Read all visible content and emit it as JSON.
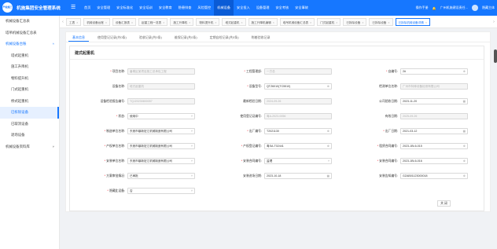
{
  "header": {
    "logo_text": "产权施工",
    "title": "机施集团安全管理系统",
    "menu_icon": "menu-icon",
    "nav": [
      "首页",
      "安全管理",
      "安全标准化",
      "安全培训",
      "安全教育",
      "隐患排查",
      "风险管控",
      "机械设备",
      "安全投入",
      "设备管理",
      "安全考核",
      "安全事故"
    ],
    "active_nav": 7,
    "manual": "操作手册",
    "user": "广州机施建设责任...",
    "account": "隐藏主体"
  },
  "sidebar": {
    "items": [
      {
        "label": "机械设备汇总表",
        "level": 0
      },
      {
        "label": "塔吊机械设备汇总表",
        "level": 0
      },
      {
        "label": "机械设备台账",
        "level": 0,
        "open": true
      },
      {
        "label": "塔式起重机",
        "level": 1
      },
      {
        "label": "施工升降机",
        "level": 1
      },
      {
        "label": "物料提升机",
        "level": 1
      },
      {
        "label": "门式起重机",
        "level": 1
      },
      {
        "label": "桥式起重机",
        "level": 1
      },
      {
        "label": "已拆除设备",
        "level": 1,
        "active": true
      },
      {
        "label": "已取消设备",
        "level": 1
      },
      {
        "label": "退场设备",
        "level": 1
      },
      {
        "label": "机械设备资料库",
        "level": 0,
        "arrow": true
      }
    ]
  },
  "tabs": [
    {
      "label": "工表"
    },
    {
      "label": "机械设备台账"
    },
    {
      "label": "设备汇报表"
    },
    {
      "label": "起重工程一览表"
    },
    {
      "label": "施工升降机"
    },
    {
      "label": "物料提升机"
    },
    {
      "label": "塔式起重机"
    },
    {
      "label": "施工升降机编辑"
    },
    {
      "label": "塔吊机械设备汇总表"
    },
    {
      "label": "门式起重机"
    },
    {
      "label": "已拆除设备"
    },
    {
      "label": "已拆除设备"
    },
    {
      "label": "已拆除机械设备详情",
      "active": true
    }
  ],
  "subtabs": [
    "基本信息",
    "使用登记记录(共0条)",
    "验收记录(共0条)",
    "维保记录(共0条)",
    "定期自检记录(共0条)",
    "附着验收记录"
  ],
  "card_title": "建式起重机",
  "fields": [
    {
      "label": "项目名称:",
      "value": "番禺区某项目施工总承包工程",
      "req": true,
      "dis": true
    },
    {
      "label": "工程管理部:",
      "value": "一方总",
      "req": true,
      "dis": true
    },
    {
      "label": "自编号:",
      "value": "2#",
      "req": true,
      "icon": "clear-icon"
    },
    {
      "label": "设备名称:",
      "value": "塔式起重机",
      "dis": true
    },
    {
      "label": "设备型号:",
      "value": "QTZ6010(TC5510)",
      "req": true,
      "icon": "clear-icon"
    },
    {
      "label": "检测单位名称:",
      "value": "广州市特种设备检测有限公司",
      "dis": true
    },
    {
      "label": "设备检验报告编号:",
      "value": "TQJ20230800057",
      "dis": true
    },
    {
      "label": "最新检验日期:",
      "value": "2024-09-26",
      "dis": true
    },
    {
      "label": "公司验收日期:",
      "value": "2023-11-20",
      "icon": "calendar-icon"
    },
    {
      "label": "状态:",
      "value": "使用中",
      "req": true,
      "icon": "chevron-icon"
    },
    {
      "label": "使用登记证编号:",
      "value": "粤A-2023-0056",
      "dis": true
    },
    {
      "label": "有效日期:",
      "value": "2025-09-26",
      "dis": true
    },
    {
      "label": "制造单位名称:",
      "value": "东莞市鼎新宏江机械制造有限公司",
      "req": true,
      "icon": "chevron-icon"
    },
    {
      "label": "出厂编号:",
      "value": "T2021130",
      "req": true,
      "icon": "clear-icon"
    },
    {
      "label": "出厂日期:",
      "value": "2021-03-12",
      "req": true,
      "icon": "calendar-icon"
    },
    {
      "label": "产权单位名称:",
      "value": "东莞市鼎新宏江机械制造有限公司",
      "req": true,
      "icon": "chevron-icon"
    },
    {
      "label": "产权登记编号:",
      "value": "粤SA-T02441",
      "req": true,
      "icon": "clear-icon"
    },
    {
      "label": "租赁合同编号:",
      "value": "2023-1Bi-6-015",
      "req": true,
      "icon": "clear-icon"
    },
    {
      "label": "安装单位名称:",
      "value": "东莞市鼎新宏江机械制造有限公司",
      "req": true,
      "icon": "chevron-icon"
    },
    {
      "label": "安装合同编号:",
      "value": "监理",
      "req": true,
      "icon": "chevron-icon"
    },
    {
      "label": "安装合同编号:",
      "value": "2023-1Bi-6-016",
      "req": true,
      "icon": "clear-icon"
    },
    {
      "label": "方案审批情况:",
      "value": "已审批",
      "req": true,
      "icon": "chevron-icon"
    },
    {
      "label": "安装进场日期:",
      "value": "2023-10-18",
      "icon": "calendar-icon"
    },
    {
      "label": "安装告知编号:",
      "value": "GZAB01123000018",
      "icon": "clear-icon"
    },
    {
      "label": "隐藏此设备:",
      "value": "否",
      "req": true,
      "icon": "chevron-icon"
    }
  ],
  "close_label": "关 闭"
}
